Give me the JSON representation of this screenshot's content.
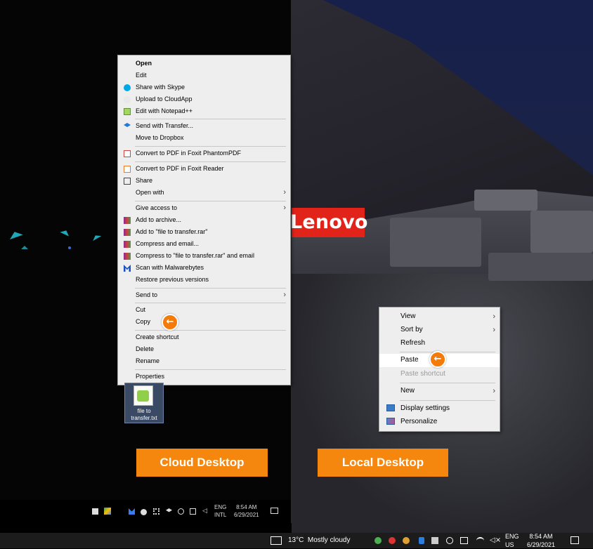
{
  "brand": {
    "logo_text": "Lenovo",
    "logo_color": "#e2231a"
  },
  "cloud_menu": {
    "items": [
      {
        "label": "Open",
        "bold": true
      },
      {
        "label": "Edit"
      },
      {
        "label": "Share with Skype",
        "icon": "skype-icon"
      },
      {
        "label": "Upload to CloudApp",
        "icon": "cloudapp-icon"
      },
      {
        "label": "Edit with Notepad++",
        "icon": "notepadpp-icon"
      },
      {
        "label": "Send with Transfer...",
        "icon": "dropbox-icon"
      },
      {
        "label": "Move to Dropbox"
      },
      {
        "label": "Convert to PDF in Foxit PhantomPDF",
        "icon": "foxit-icon"
      },
      {
        "label": "Convert to PDF in Foxit Reader",
        "icon": "foxit-icon"
      },
      {
        "label": "Share",
        "icon": "share-icon"
      },
      {
        "label": "Open with",
        "submenu": true
      },
      {
        "label": "Give access to",
        "submenu": true
      },
      {
        "label": "Add to archive...",
        "icon": "winrar-icon"
      },
      {
        "label": "Add to \"file to transfer.rar\"",
        "icon": "winrar-icon"
      },
      {
        "label": "Compress and email...",
        "icon": "winrar-icon"
      },
      {
        "label": "Compress to \"file to transfer.rar\" and email",
        "icon": "winrar-icon"
      },
      {
        "label": "Scan with Malwarebytes",
        "icon": "malwarebytes-icon"
      },
      {
        "label": "Restore previous versions"
      },
      {
        "label": "Send to",
        "submenu": true
      },
      {
        "label": "Cut"
      },
      {
        "label": "Copy"
      },
      {
        "label": "Create shortcut"
      },
      {
        "label": "Delete"
      },
      {
        "label": "Rename"
      },
      {
        "label": "Properties"
      }
    ]
  },
  "local_menu": {
    "items": [
      {
        "label": "View",
        "submenu": true
      },
      {
        "label": "Sort by",
        "submenu": true
      },
      {
        "label": "Refresh"
      },
      {
        "label": "Paste",
        "highlighted": true
      },
      {
        "label": "Paste shortcut",
        "disabled": true
      },
      {
        "label": "New",
        "submenu": true
      },
      {
        "label": "Display settings",
        "icon": "display-settings-icon"
      },
      {
        "label": "Personalize",
        "icon": "personalize-icon"
      }
    ]
  },
  "desktop_file": {
    "name_line1": "file to",
    "name_line2": "transfer.txt"
  },
  "labels": {
    "cloud": "Cloud Desktop",
    "local": "Local Desktop"
  },
  "cloud_taskbar": {
    "lang1": "ENG",
    "lang2": "INTL",
    "time": "8:54 AM",
    "date": "6/29/2021"
  },
  "taskbar": {
    "weather": "13°C  Mostly cloudy",
    "lang1": "ENG",
    "lang2": "US",
    "time": "8:54 AM",
    "date": "6/29/2021"
  },
  "colors": {
    "accent": "#f47a0a",
    "label_bg": "#f5860e"
  }
}
